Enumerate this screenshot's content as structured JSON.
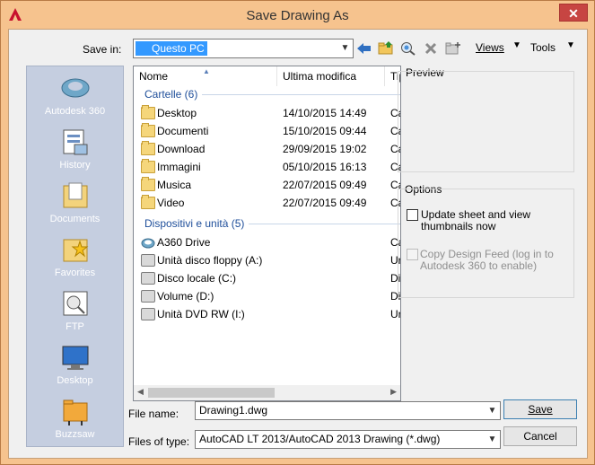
{
  "window": {
    "title": "Save Drawing As",
    "close_glyph": "✕",
    "app_icon": "autocad-a-icon"
  },
  "toolbar": {
    "save_in_label": "Save in:",
    "save_in_value": "Questo PC",
    "views_label": "Views",
    "tools_label": "Tools",
    "icons": [
      "back-arrow-icon",
      "up-one-level-folder-icon",
      "search-web-icon",
      "delete-icon",
      "create-folder-icon"
    ]
  },
  "places": [
    {
      "label": "Autodesk 360",
      "icon": "autodesk-360-icon"
    },
    {
      "label": "History",
      "icon": "history-icon"
    },
    {
      "label": "Documents",
      "icon": "documents-folder-icon"
    },
    {
      "label": "Favorites",
      "icon": "favorites-folder-icon"
    },
    {
      "label": "FTP",
      "icon": "ftp-icon"
    },
    {
      "label": "Desktop",
      "icon": "desktop-icon"
    },
    {
      "label": "Buzzsaw",
      "icon": "buzzsaw-icon"
    }
  ],
  "filelist": {
    "columns": {
      "name": "Nome",
      "modified": "Ultima modifica",
      "type": "Tip"
    },
    "groups": [
      {
        "header": "Cartelle (6)",
        "items": [
          {
            "name": "Desktop",
            "modified": "14/10/2015 14:49",
            "type": "Ca"
          },
          {
            "name": "Documenti",
            "modified": "15/10/2015 09:44",
            "type": "Ca"
          },
          {
            "name": "Download",
            "modified": "29/09/2015 19:02",
            "type": "Ca"
          },
          {
            "name": "Immagini",
            "modified": "05/10/2015 16:13",
            "type": "Ca"
          },
          {
            "name": "Musica",
            "modified": "22/07/2015 09:49",
            "type": "Ca"
          },
          {
            "name": "Video",
            "modified": "22/07/2015 09:49",
            "type": "Ca"
          }
        ]
      },
      {
        "header": "Dispositivi e unità (5)",
        "items": [
          {
            "name": "A360 Drive",
            "modified": "",
            "type": "Ca"
          },
          {
            "name": "Unità disco floppy (A:)",
            "modified": "",
            "type": "Ur"
          },
          {
            "name": "Disco locale (C:)",
            "modified": "",
            "type": "Di"
          },
          {
            "name": "Volume (D:)",
            "modified": "",
            "type": "Di"
          },
          {
            "name": "Unità DVD RW (I:)",
            "modified": "",
            "type": "Ur"
          }
        ]
      }
    ]
  },
  "preview": {
    "title": "Preview"
  },
  "options": {
    "title": "Options",
    "update_thumbnails_label_1": "Update sheet and view",
    "update_thumbnails_label_2": "thumbnails now",
    "copy_feed_label_1": "Copy Design Feed (log in to",
    "copy_feed_label_2": "Autodesk 360 to enable)"
  },
  "bottom": {
    "file_name_label": "File name:",
    "file_name_value": "Drawing1.dwg",
    "file_type_label": "Files of type:",
    "file_type_value": "AutoCAD LT 2013/AutoCAD 2013 Drawing (*.dwg)",
    "save_label": "Save",
    "cancel_label": "Cancel"
  }
}
